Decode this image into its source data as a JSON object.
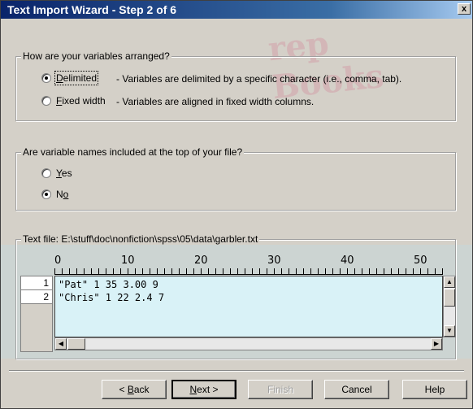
{
  "window": {
    "title": "Text Import Wizard - Step 2 of 6",
    "close_label": "x"
  },
  "watermark": "rep Books",
  "arrangement": {
    "legend": "How are your variables arranged?",
    "options": [
      {
        "label": "Delimited",
        "accel": "D",
        "rest": "elimited",
        "desc": "- Variables are delimited by a specific character (i.e., comma, tab).",
        "selected": true
      },
      {
        "label": "Fixed width",
        "accel": "F",
        "rest": "ixed width",
        "desc": "- Variables are aligned in fixed width columns.",
        "selected": false
      }
    ]
  },
  "names": {
    "legend": "Are variable names included at the top of your file?",
    "options": [
      {
        "label": "Yes",
        "accel": "Y",
        "rest": "es",
        "selected": false
      },
      {
        "label": "No",
        "accel": "o",
        "pre": "N",
        "selected": true
      }
    ]
  },
  "preview": {
    "legend": "Text file: E:\\stuff\\doc\\nonfiction\\spss\\05\\data\\garbler.txt",
    "ruler": [
      "0",
      "10",
      "20",
      "30",
      "40",
      "50"
    ],
    "row_numbers": [
      "1",
      "2"
    ],
    "rows": [
      "\"Pat\" 1 35 3.00 9",
      "\"Chris\" 1 22 2.4 7"
    ]
  },
  "buttons": {
    "back": {
      "pre": "< ",
      "accel": "B",
      "rest": "ack"
    },
    "next": {
      "accel": "N",
      "rest": "ext >"
    },
    "finish": "Finish",
    "cancel": "Cancel",
    "help": "Help"
  },
  "colors": {
    "titlebar": "#0a246a",
    "dialog": "#d4d0c8",
    "grid_bg": "#d9f2f7"
  }
}
